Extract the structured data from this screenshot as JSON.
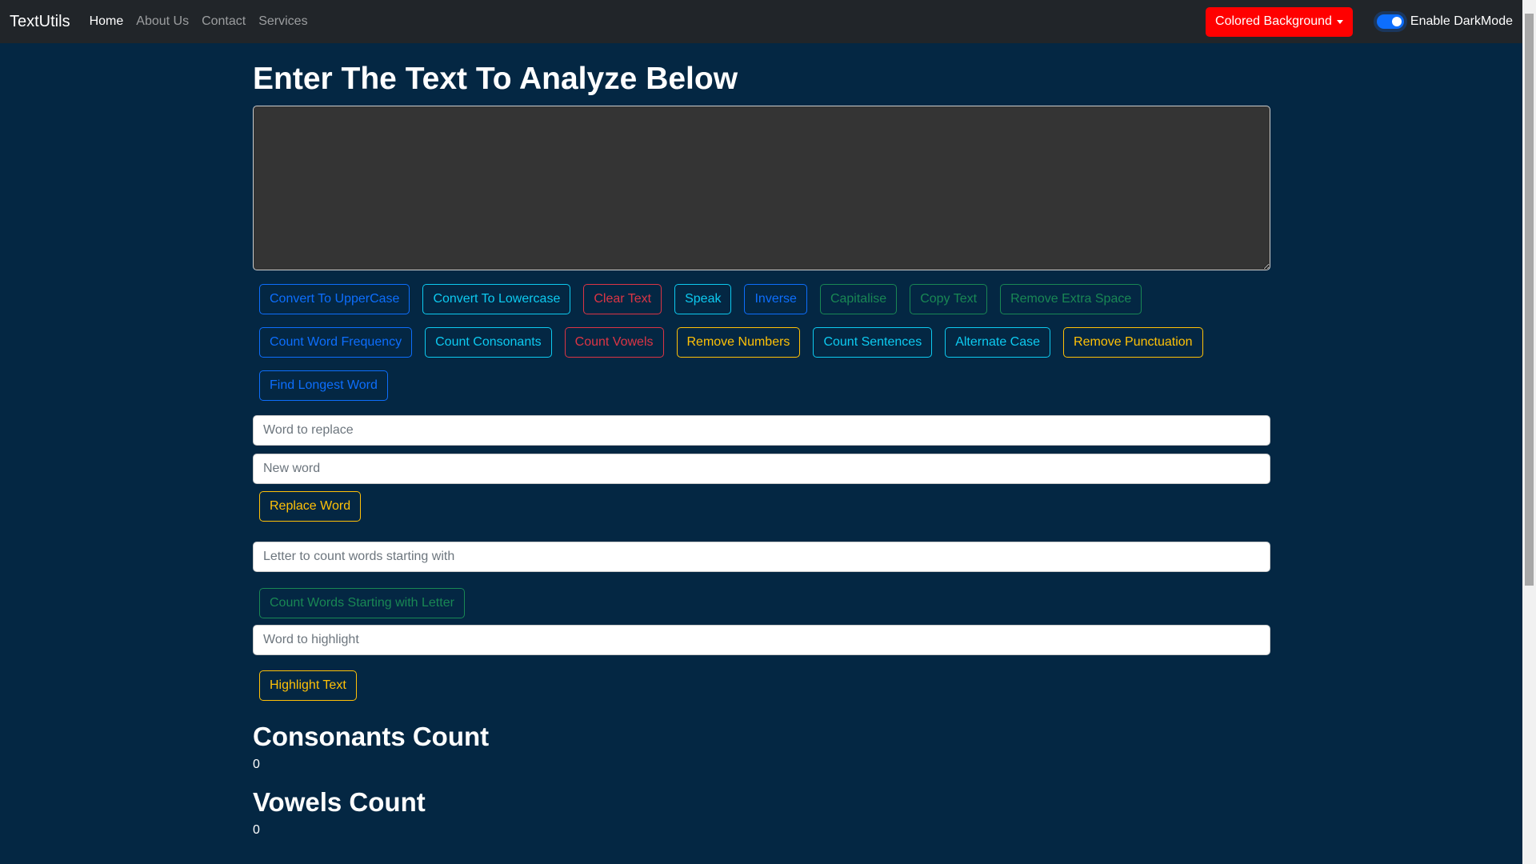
{
  "nav": {
    "brand": "TextUtils",
    "links": [
      "Home",
      "About Us",
      "Contact",
      "Services"
    ],
    "dropdown": "Colored Background",
    "darkmode_label": "Enable DarkMode",
    "darkmode_on": true
  },
  "main": {
    "title": "Enter The Text To Analyze Below",
    "textarea_value": "",
    "buttons": [
      {
        "label": "Convert To UpperCase",
        "variant": "primary"
      },
      {
        "label": "Convert To Lowercase",
        "variant": "info"
      },
      {
        "label": "Clear Text",
        "variant": "danger"
      },
      {
        "label": "Speak",
        "variant": "info"
      },
      {
        "label": "Inverse",
        "variant": "primary"
      },
      {
        "label": "Capitalise",
        "variant": "success"
      },
      {
        "label": "Copy Text",
        "variant": "success"
      },
      {
        "label": "Remove Extra Space",
        "variant": "success"
      },
      {
        "label": "Count Word Frequency",
        "variant": "primary"
      },
      {
        "label": "Count Consonants",
        "variant": "info"
      },
      {
        "label": "Count Vowels",
        "variant": "danger"
      },
      {
        "label": "Remove Numbers",
        "variant": "warning"
      },
      {
        "label": "Count Sentences",
        "variant": "info"
      },
      {
        "label": "Alternate Case",
        "variant": "info"
      },
      {
        "label": "Remove Punctuation",
        "variant": "warning"
      },
      {
        "label": "Find Longest Word",
        "variant": "primary"
      }
    ],
    "replace": {
      "word_placeholder": "Word to replace",
      "new_placeholder": "New word",
      "button": "Replace Word"
    },
    "letter": {
      "placeholder": "Letter to count words starting with",
      "button": "Count Words Starting with Letter"
    },
    "highlight": {
      "placeholder": "Word to highlight",
      "button": "Highlight Text"
    },
    "consonants": {
      "title": "Consonants Count",
      "value": "0"
    },
    "vowels": {
      "title": "Vowels Count",
      "value": "0"
    }
  },
  "colors": {
    "navbar": "#212529",
    "background": "#042743",
    "dropdown": "#ff0000"
  }
}
